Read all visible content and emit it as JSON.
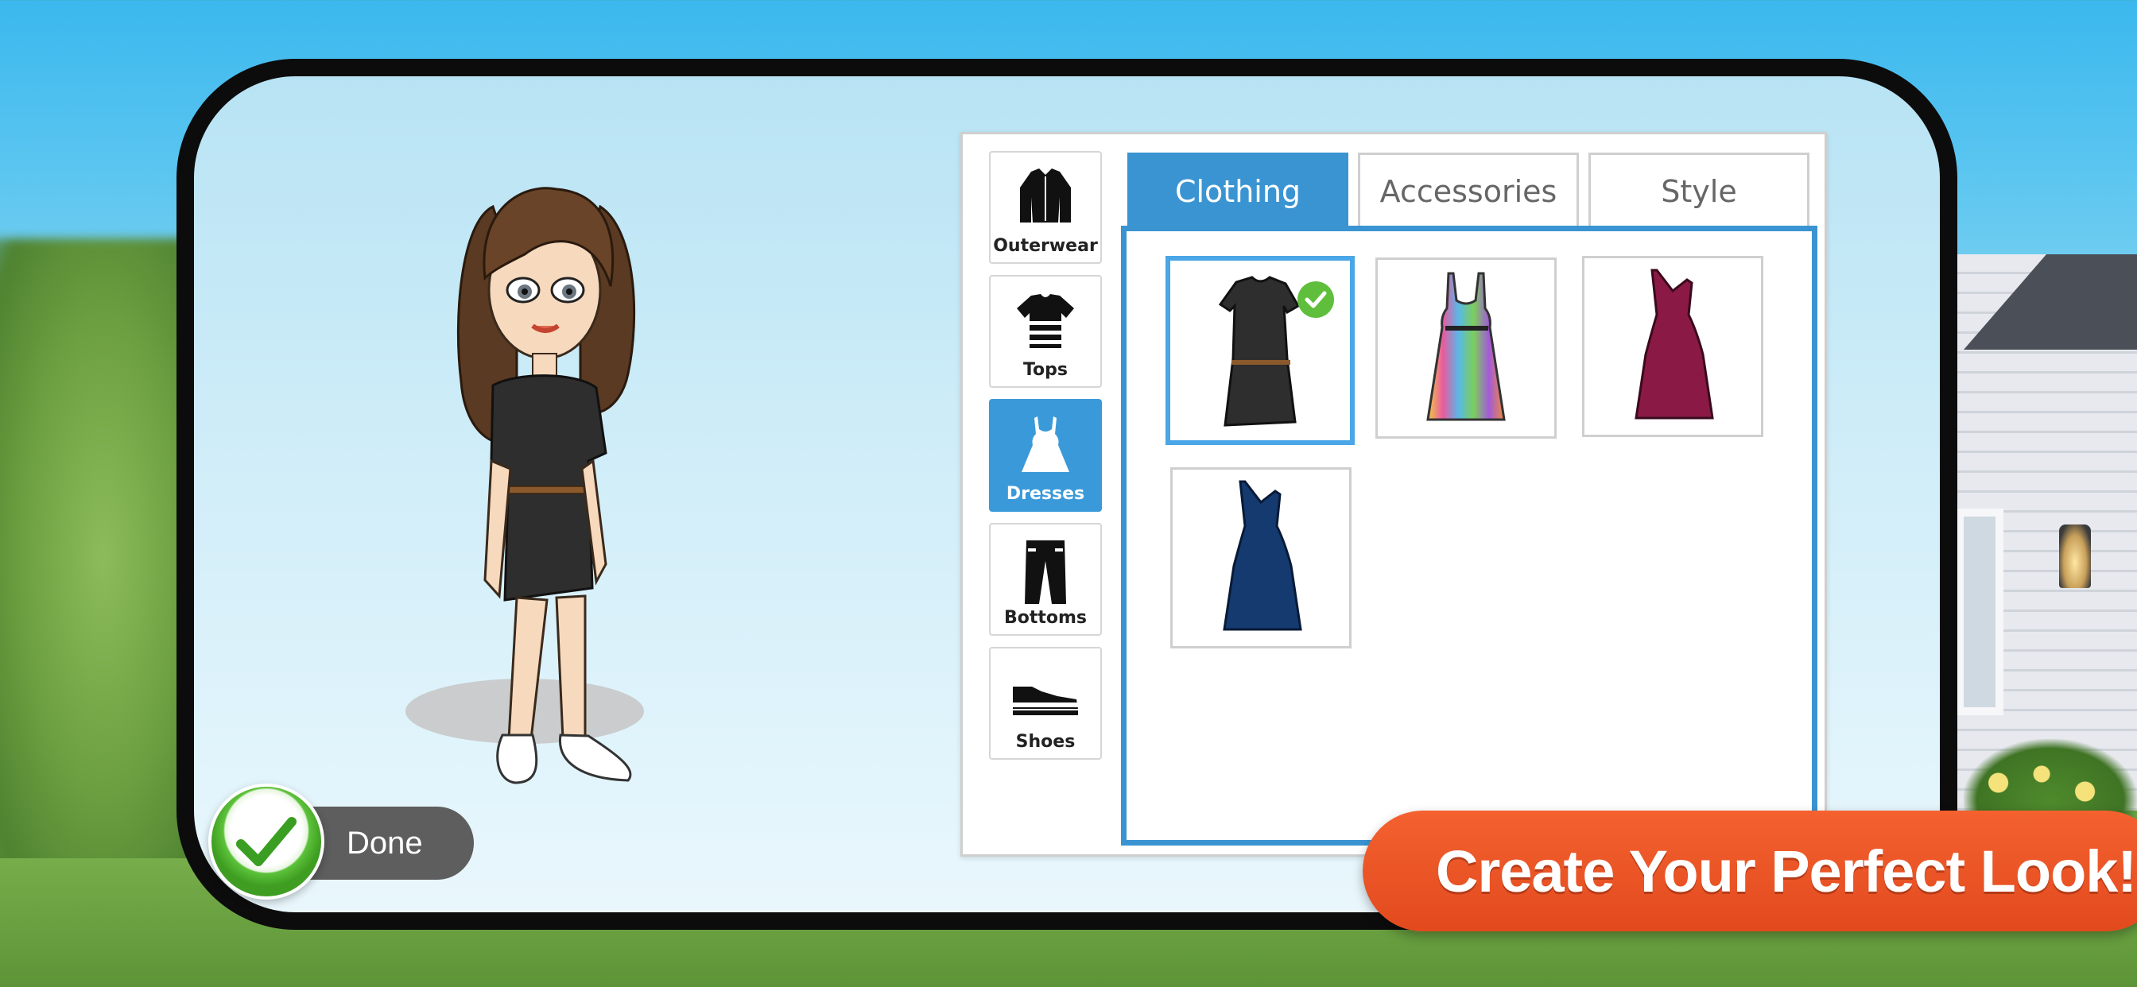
{
  "categories": [
    {
      "label": "Outerwear",
      "icon": "jacket-icon"
    },
    {
      "label": "Tops",
      "icon": "striped-shirt-icon"
    },
    {
      "label": "Dresses",
      "icon": "dress-icon",
      "active": true
    },
    {
      "label": "Bottoms",
      "icon": "pants-icon"
    },
    {
      "label": "Shoes",
      "icon": "sneaker-icon"
    }
  ],
  "tabs": [
    {
      "label": "Clothing",
      "active": true
    },
    {
      "label": "Accessories"
    },
    {
      "label": "Style"
    }
  ],
  "items": [
    {
      "name": "black-belted-dress",
      "color": "#2e2e2e",
      "selected": true
    },
    {
      "name": "multicolor-print-dress",
      "color": "#e85aa0"
    },
    {
      "name": "burgundy-asymmetric-dress",
      "color": "#8a1a45"
    },
    {
      "name": "navy-asymmetric-dress",
      "color": "#143a70"
    }
  ],
  "done": {
    "label": "Done"
  },
  "promo": {
    "text": "Create Your Perfect Look!"
  },
  "colors": {
    "accent": "#3a94d2",
    "done_green": "#5fbf3c",
    "promo_orange": "#f05a28"
  }
}
